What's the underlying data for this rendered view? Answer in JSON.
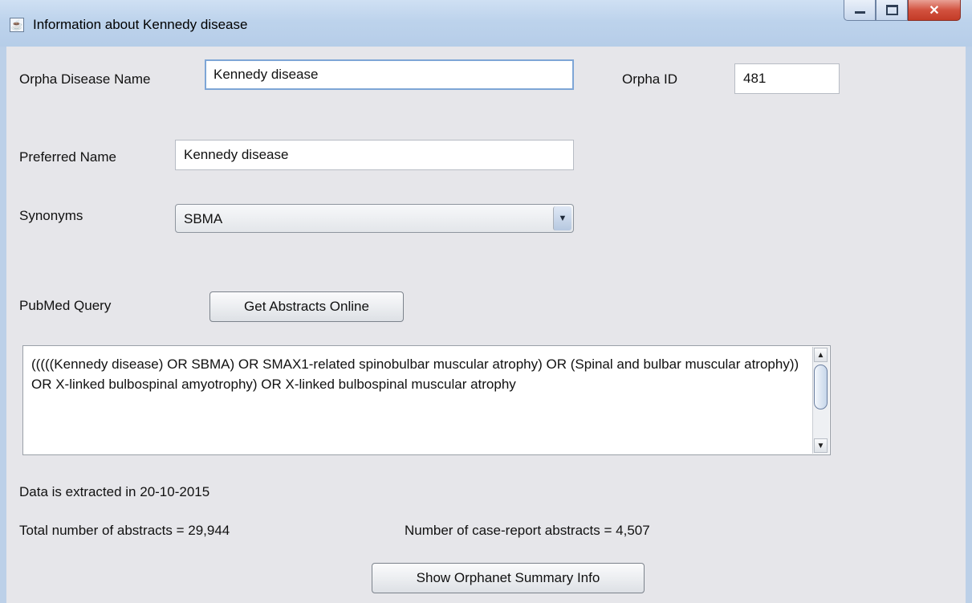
{
  "window": {
    "title": "Information about Kennedy disease"
  },
  "form": {
    "orpha_disease_name_label": "Orpha Disease Name",
    "orpha_disease_name_value": "Kennedy disease",
    "orpha_id_label": "Orpha ID",
    "orpha_id_value": "481",
    "preferred_name_label": "Preferred Name",
    "preferred_name_value": "Kennedy disease",
    "synonyms_label": "Synonyms",
    "synonyms_selected": "SBMA"
  },
  "pubmed": {
    "label": "PubMed Query",
    "button_label": "Get Abstracts Online",
    "query_text": "(((((Kennedy disease) OR SBMA) OR SMAX1-related spinobulbar muscular atrophy) OR (Spinal and bulbar muscular atrophy)) OR X-linked bulbospinal amyotrophy) OR X-linked bulbospinal muscular atrophy"
  },
  "stats": {
    "extracted_text": "Data is extracted in 20-10-2015",
    "total_abstracts_text": "Total number of abstracts = 29,944",
    "case_report_text": "Number of case-report abstracts = 4,507"
  },
  "footer": {
    "summary_button_label": "Show Orphanet Summary Info"
  },
  "icons": {
    "app": "java-cup-icon",
    "minimize": "minimize-icon",
    "maximize": "maximize-icon",
    "close": "close-icon",
    "dropdown": "chevron-down-icon"
  },
  "colors": {
    "titlebar": "#bcd0e8",
    "panel": "#e6e6ea",
    "focus_border": "#7ea6d6",
    "close_button": "#c33b27"
  }
}
